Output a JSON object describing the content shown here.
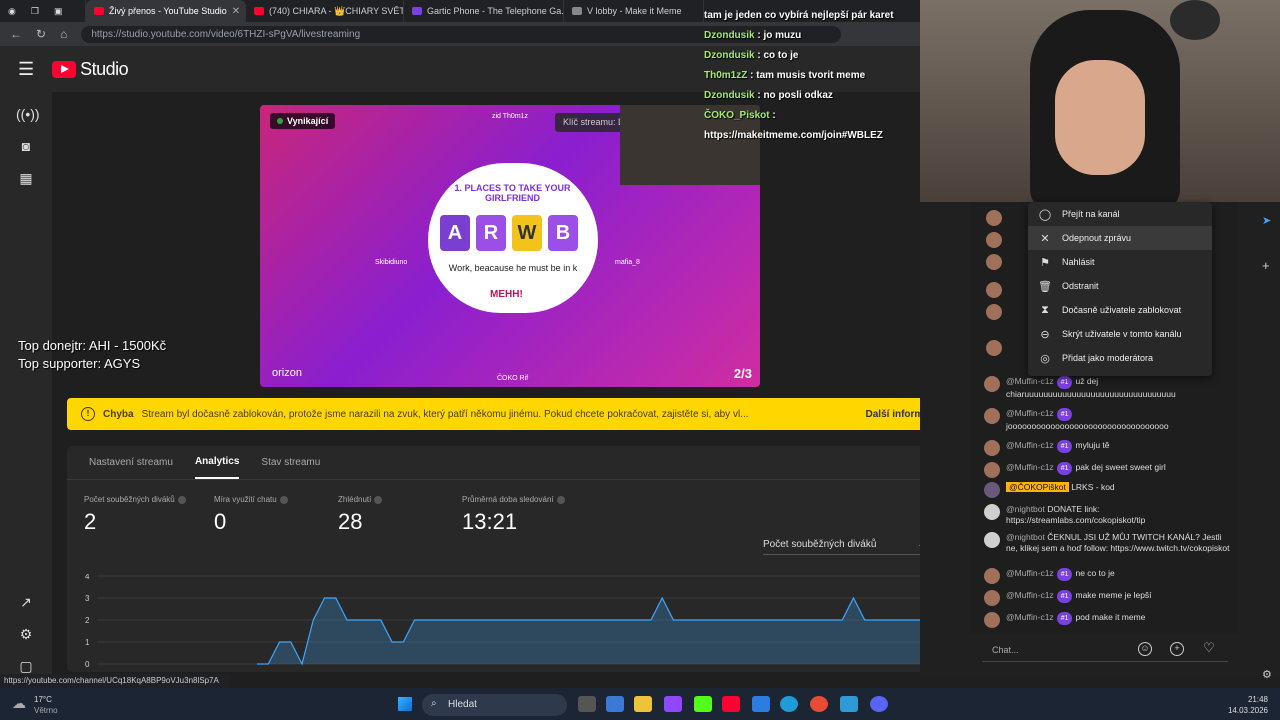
{
  "browser": {
    "tabs": [
      {
        "label": "Živý přenos - YouTube Studio",
        "active": true,
        "color": "#ff0033"
      },
      {
        "label": "(740) CHIARA - 👑CHIARY SVĚT 👑",
        "active": false,
        "color": "#ff0033"
      },
      {
        "label": "Gartic Phone - The Telephone Ga...",
        "active": false,
        "color": "#7a40e0"
      },
      {
        "label": "V lobby - Make it Meme",
        "active": false,
        "color": "#888888"
      }
    ],
    "url": "https://studio.youtube.com/video/6THZI-sPgVA/livestreaming",
    "status_url": "https://youtube.com/channel/UCq18KqA8BP9oVJu3n8lSp7A"
  },
  "studio": {
    "logo_text": "Studio"
  },
  "preview": {
    "badge": "Vynikající",
    "stream_key": "Klíč streamu: Default strear",
    "card_title": "1. PLACES TO TAKE YOUR GIRLFRIEND",
    "letters": [
      "A",
      "R",
      "W",
      "B"
    ],
    "card_text": "Work, beacause he must be in k",
    "meh": "MEHH!",
    "brand": "orizon",
    "players_count": "2/3",
    "players": [
      "zid Th0m1z",
      "Skibidiuno",
      "mafia_8",
      "ČOKO Rif"
    ]
  },
  "overlay": {
    "top_donor": "Top donejtr: AHI - 1500Kč",
    "top_supporter": "Top supporter: AGYS",
    "chat_lines": [
      {
        "name": "",
        "text": "tam je jeden co vybírá nejlepší pár karet"
      },
      {
        "name": "Dzondusik",
        "text": ": jo muzu"
      },
      {
        "name": "Dzondusik",
        "text": ": co to je"
      },
      {
        "name": "Th0m1zZ",
        "text": ": tam musis tvorit meme"
      },
      {
        "name": "Dzondusik",
        "text": ": no posli odkaz"
      },
      {
        "name": "ČOKO_Piskot",
        "text": ":"
      },
      {
        "name": "",
        "text": "https://makeitmeme.com/join#WBLEZ"
      }
    ]
  },
  "error": {
    "title": "Chyba",
    "message": "Stream byl dočasně zablokován, protože jsme narazili na zvuk, který patří někomu jinému. Pokud chcete pokračovat, zajistěte si, aby vl...",
    "link": "Další informace"
  },
  "panel": {
    "tabs": [
      "Nastavení streamu",
      "Analytics",
      "Stav streamu"
    ],
    "metrics": [
      {
        "label": "Počet souběžných diváků",
        "value": "2"
      },
      {
        "label": "Míra využití chatu",
        "value": "0"
      },
      {
        "label": "Zhlédnutí",
        "value": "28"
      },
      {
        "label": "Průměrná doba sledování",
        "value": "13:21"
      }
    ],
    "dropdown": "Počet souběžných diváků"
  },
  "chart_data": {
    "type": "area",
    "y_ticks": [
      "4",
      "3",
      "2",
      "1",
      "0"
    ],
    "ylim": [
      0,
      4
    ],
    "color": "#3ea6ff",
    "values": [
      0,
      0,
      1,
      1,
      0,
      2,
      3,
      3,
      2,
      2,
      2,
      2,
      1,
      1,
      2,
      2,
      2,
      2,
      2,
      2,
      2,
      2,
      2,
      2,
      2,
      2,
      2,
      2,
      2,
      2,
      2,
      2,
      2,
      2,
      2,
      2,
      3,
      2,
      2,
      2,
      2,
      2,
      2,
      2,
      2,
      2,
      2,
      2,
      2,
      2,
      2,
      2,
      2,
      3,
      2,
      2,
      2,
      2,
      2,
      2
    ]
  },
  "context_menu": {
    "items": [
      {
        "label": "Přejít na kanál",
        "icon": "user-icon"
      },
      {
        "label": "Odepnout zprávu",
        "icon": "unpin-icon"
      },
      {
        "label": "Nahlásit",
        "icon": "flag-icon"
      },
      {
        "label": "Odstranit",
        "icon": "trash-icon"
      },
      {
        "label": "Dočasně uživatele zablokovat",
        "icon": "hourglass-icon"
      },
      {
        "label": "Skrýt uživatele v tomto kanálu",
        "icon": "block-icon"
      },
      {
        "label": "Přidat jako moderátora",
        "icon": "moderator-icon"
      }
    ]
  },
  "chat": {
    "messages": [
      {
        "name": "@Muffin-c1z",
        "badge": "#1",
        "text": "už dej chiaruuuuuuuuuuuuuuuuuuuuuuuuuuuuuuuu"
      },
      {
        "name": "@Muffin-c1z",
        "badge": "#1",
        "text": "joooooooooooooooooooooooooooooooooo"
      },
      {
        "name": "@Muffin-c1z",
        "badge": "#1",
        "text": "myluju tě"
      },
      {
        "name": "@Muffin-c1z",
        "badge": "#1",
        "text": "pak dej sweet sweet girl"
      },
      {
        "name": "@ČOKOPiškot",
        "badge": "",
        "text": "LRKS - kod"
      },
      {
        "name": "@nightbot",
        "badge": "",
        "text": "DONATE link: https://streamlabs.com/cokopiskot/tip"
      },
      {
        "name": "@nightbot",
        "badge": "",
        "text": "ČEKNUL JSI UŽ MŮJ TWITCH KANÁL? Jestli ne, klikej sem a hoď follow: https://www.twitch.tv/cokopiskot"
      },
      {
        "name": "@Muffin-c1z",
        "badge": "#1",
        "text": "ne co to je"
      },
      {
        "name": "@Muffin-c1z",
        "badge": "#1",
        "text": "make meme je lepší"
      },
      {
        "name": "@Muffin-c1z",
        "badge": "#1",
        "text": "pod make it meme"
      }
    ],
    "input_placeholder": "Chat..."
  },
  "taskbar": {
    "weather_temp": "17°C",
    "weather_desc": "Větrno",
    "search": "Hledat",
    "time": "21:48",
    "date": "14.03.2026"
  }
}
